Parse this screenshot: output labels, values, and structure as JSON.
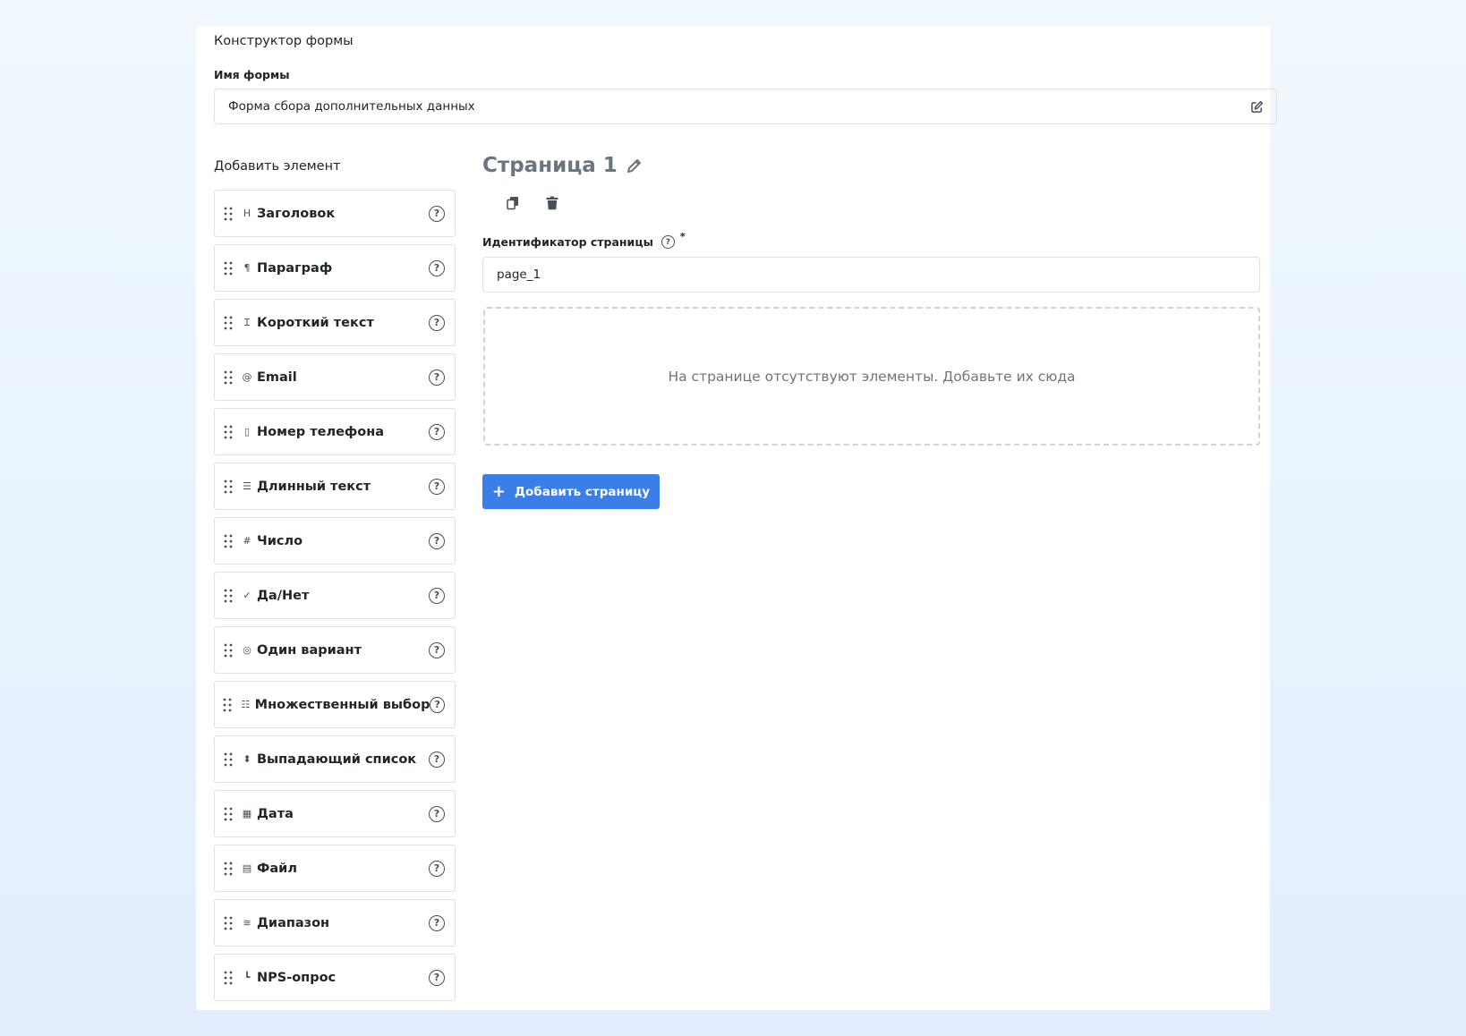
{
  "builder": {
    "title": "Конструктор формы",
    "form_name_label": "Имя формы",
    "form_name_value": "Форма сбора дополнительных данных"
  },
  "palette": {
    "title": "Добавить элемент",
    "help_glyph": "?",
    "items": [
      {
        "label": "Заголовок",
        "icon": "heading-icon",
        "glyph": "H"
      },
      {
        "label": "Параграф",
        "icon": "paragraph-icon",
        "glyph": "¶"
      },
      {
        "label": "Короткий текст",
        "icon": "text-cursor-icon",
        "glyph": "Ɪ"
      },
      {
        "label": "Email",
        "icon": "at-icon",
        "glyph": "@"
      },
      {
        "label": "Номер телефона",
        "icon": "mobile-phone-icon",
        "glyph": "▯"
      },
      {
        "label": "Длинный текст",
        "icon": "indent-icon",
        "glyph": "☰"
      },
      {
        "label": "Число",
        "icon": "hashtag-icon",
        "glyph": "#"
      },
      {
        "label": "Да/Нет",
        "icon": "check-icon",
        "glyph": "✓"
      },
      {
        "label": "Один вариант",
        "icon": "radio-bullseye-icon",
        "glyph": "◎"
      },
      {
        "label": "Множественный выбор",
        "icon": "checklist-icon",
        "glyph": "☷"
      },
      {
        "label": "Выпадающий список",
        "icon": "sort-icon",
        "glyph": "⬍"
      },
      {
        "label": "Дата",
        "icon": "calendar-icon",
        "glyph": "▦"
      },
      {
        "label": "Файл",
        "icon": "file-icon",
        "glyph": "▤"
      },
      {
        "label": "Диапазон",
        "icon": "sliders-icon",
        "glyph": "≋"
      },
      {
        "label": "NPS-опрос",
        "icon": "bar-chart-icon",
        "glyph": "┗"
      }
    ]
  },
  "page": {
    "title": "Страница 1",
    "id_label": "Идентификатор страницы",
    "help_glyph": "?",
    "required_mark": "*",
    "id_value": "page_1",
    "empty_text": "На странице отсутствуют элементы. Добавьте их сюда",
    "add_page_plus": "+",
    "add_page_label": "Добавить страницу"
  },
  "colors": {
    "primary_button": "#3a7ee8",
    "muted_text": "#6c757d",
    "border": "#dee2e6"
  }
}
